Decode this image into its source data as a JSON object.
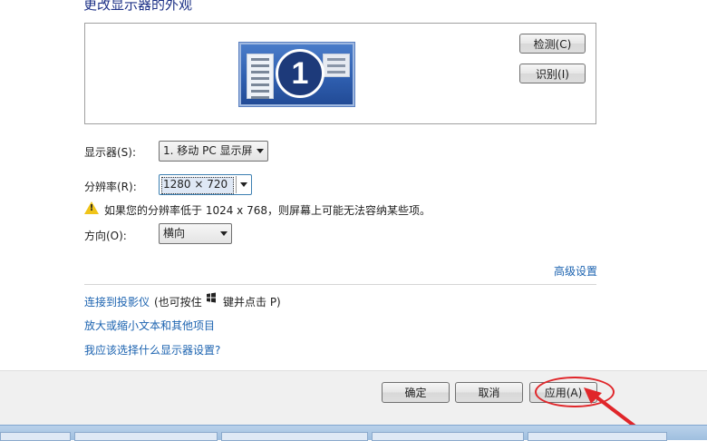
{
  "page_title": "更改显示器的外观",
  "preview": {
    "monitor_number": "1",
    "detect_label": "检测(C)",
    "identify_label": "识别(I)"
  },
  "display": {
    "label": "显示器(S):",
    "value": "1. 移动 PC 显示屏"
  },
  "resolution": {
    "label": "分辨率(R):",
    "value": "1280 × 720"
  },
  "warning_text": "如果您的分辨率低于 1024 x 768，则屏幕上可能无法容纳某些项。",
  "orientation": {
    "label": "方向(O):",
    "value": "横向"
  },
  "advanced_link": "高级设置",
  "projector": {
    "link": "连接到投影仪",
    "hint_prefix": "(也可按住",
    "hint_suffix": "键并点击 P)"
  },
  "text_size_link": "放大或缩小文本和其他项目",
  "help_link": "我应该选择什么显示器设置?",
  "buttons": {
    "ok": "确定",
    "cancel": "取消",
    "apply": "应用(A)"
  },
  "colors": {
    "link": "#1c63b0",
    "title": "#1e3287",
    "annotation": "#e0262a"
  }
}
